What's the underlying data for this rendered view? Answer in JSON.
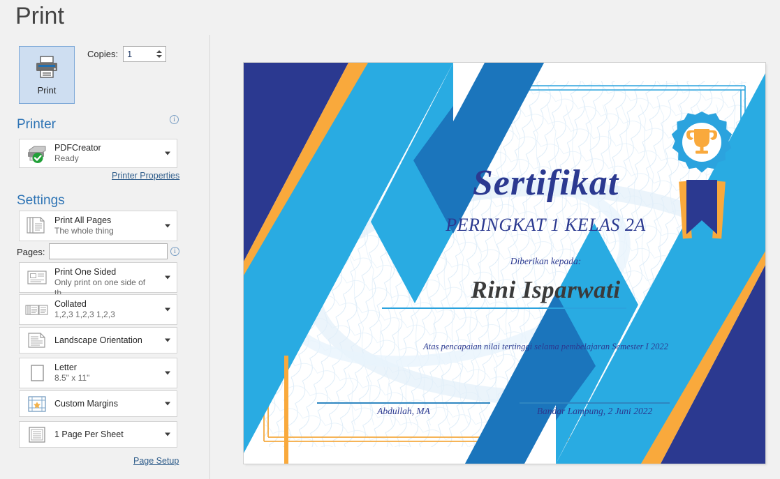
{
  "window": {
    "title": "Print"
  },
  "print_button": {
    "label": "Print",
    "icon": "printer-icon"
  },
  "copies": {
    "label": "Copies:",
    "value": "1"
  },
  "printer": {
    "heading": "Printer",
    "name": "PDFCreator",
    "status": "Ready",
    "icon": "printer-ready-icon",
    "info_icon": "info-icon",
    "properties_link": "Printer Properties"
  },
  "settings": {
    "heading": "Settings",
    "pages_label": "Pages:",
    "pages_value": "",
    "pages_info_icon": "info-icon",
    "page_setup_link": "Page Setup",
    "rows": [
      {
        "title": "Print All Pages",
        "subtitle": "The whole thing",
        "icon": "all-pages-icon"
      },
      {
        "title": "Print One Sided",
        "subtitle": "Only print on one side of th...",
        "icon": "one-sided-icon"
      },
      {
        "title": "Collated",
        "subtitle": "1,2,3   1,2,3   1,2,3",
        "icon": "collated-icon"
      },
      {
        "title": "Landscape Orientation",
        "subtitle": "",
        "icon": "landscape-icon"
      },
      {
        "title": "Letter",
        "subtitle": "8.5\" x 11\"",
        "icon": "paper-size-icon"
      },
      {
        "title": "Custom Margins",
        "subtitle": "",
        "icon": "margins-icon"
      },
      {
        "title": "1 Page Per Sheet",
        "subtitle": "",
        "icon": "pages-per-sheet-icon"
      }
    ]
  },
  "preview": {
    "certificate": {
      "title": "Sertifikat",
      "subtitle": "PERINGKAT 1 KELAS 2A",
      "awarded_to_label": "Diberikan kepada:",
      "recipient": "Rini Isparwati",
      "reason": "Atas pencapaian nilai tertinggi selama pembelajaran Semester I 2022",
      "signature_left": "Abdullah, MA",
      "signature_right": "Bandar Lampung, 2 Juni 2022",
      "badge_icon": "award-trophy-badge-icon"
    }
  },
  "colors": {
    "navy": "#2B3990",
    "light_blue": "#29ABE2",
    "mid_blue": "#1B75BC",
    "orange": "#F9A93C",
    "heading_blue": "#2E74B5",
    "link_blue": "#2E5C8A",
    "panel_bg": "#F1F1F1"
  }
}
